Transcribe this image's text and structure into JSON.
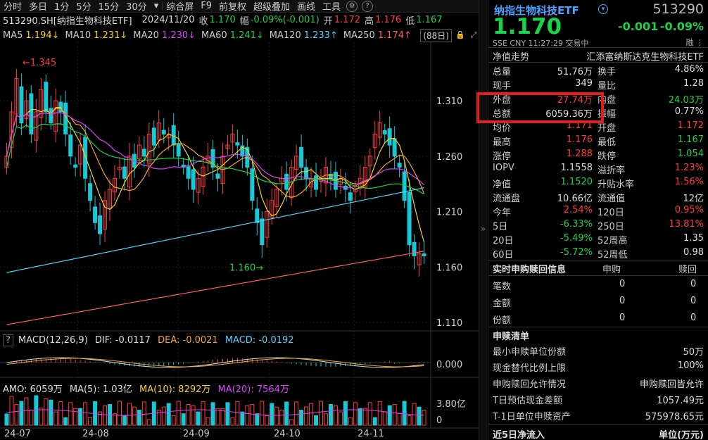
{
  "toolbar": {
    "periods": [
      "分时",
      "多日",
      "1分",
      "5分",
      "15分",
      "30分"
    ],
    "tools": [
      "综合屏",
      "F9",
      "前复权",
      "超级叠加",
      "画线",
      "工具"
    ]
  },
  "info": {
    "code_name": "513290.SH[纳指生物科技ETF]",
    "date": "2024/11/20",
    "close_label": "收",
    "close": "1.170",
    "change_label": "幅",
    "change": "-0.09%(-0.001)",
    "open_label": "开",
    "open": "1.172",
    "high_label": "高",
    "high": "1.176",
    "low_label": "低",
    "low": "1.167"
  },
  "ma_row": [
    {
      "label": "MA5",
      "value": "1.194↓",
      "color": "#ffffff"
    },
    {
      "label": "MA10",
      "value": "1.231↓",
      "color": "#f5d21b"
    },
    {
      "label": "MA20",
      "value": "1.230↓",
      "color": "#e040fb"
    },
    {
      "label": "MA60",
      "value": "1.241↓",
      "color": "#19d34a"
    },
    {
      "label": "MA120",
      "value": "1.233↑",
      "color": "#4ad3ff"
    },
    {
      "label": "MA250",
      "value": "1.174↑",
      "color": "#ff5c5c"
    }
  ],
  "ma_count": "(88日)",
  "price_axis": [
    "1.310",
    "1.260",
    "1.210",
    "1.160",
    "1.110"
  ],
  "annotations": {
    "high": "←1.345",
    "low": "1.160→"
  },
  "macd": {
    "title": "MACD(12,26,9)",
    "dif_label": "DIF:",
    "dif": "-0.0117",
    "dea_label": "DEA:",
    "dea": "-0.0021",
    "macd_label": "MACD:",
    "macd": "-0.0192",
    "axis_zero": "0.000"
  },
  "amo": {
    "title": "AMO: 6059万",
    "ma5": "MA(5): 1.03亿",
    "ma10": "MA(10): 8292万",
    "ma20": "MA(20): 7564万",
    "axis_top": "3.80亿",
    "axis_zero": "0"
  },
  "dates": [
    "24-07",
    "24-08",
    "24-09",
    "24-10",
    "24-11"
  ],
  "quote": {
    "name": "纳指生物科技ETF",
    "code": "513290",
    "price": "1.170",
    "change": "-0.001",
    "pct": "-0.09%",
    "sub": "SSE  CNY  11:27:29  交易中",
    "sub_right": "融 ⋮",
    "nav_trend_label": "净值走势",
    "fund_company": "汇添富纳斯达克生物科技ETF"
  },
  "stats": [
    {
      "l1": "总量",
      "v1": "51.76万",
      "c1": "white",
      "l2": "换手",
      "v2": "4.86%",
      "c2": "white"
    },
    {
      "l1": "现手",
      "v1": "349",
      "c1": "white",
      "l2": "量比",
      "v2": "1.28",
      "c2": "white"
    },
    {
      "l1": "外盘",
      "v1": "27.74万",
      "c1": "red",
      "l2": "内盘",
      "v2": "24.03万",
      "c2": "green"
    },
    {
      "l1": "总额",
      "v1": "6059.36万",
      "c1": "white",
      "l2": "振幅",
      "v2": "0.77%",
      "c2": "white"
    },
    {
      "l1": "均价",
      "v1": "1.171",
      "c1": "red",
      "l2": "开盘",
      "v2": "1.172",
      "c2": "red"
    },
    {
      "l1": "最高",
      "v1": "1.176",
      "c1": "red",
      "l2": "最低",
      "v2": "1.167",
      "c2": "green"
    },
    {
      "l1": "涨停",
      "v1": "1.288",
      "c1": "red",
      "l2": "跌停",
      "v2": "1.054",
      "c2": "green"
    },
    {
      "l1": "IOPV",
      "v1": "1.1558",
      "c1": "white",
      "l2": "溢折率",
      "v2": "1.23%",
      "c2": "red"
    },
    {
      "l1": "净值",
      "v1": "1.1520",
      "c1": "green",
      "l2": "升贴水率",
      "v2": "1.56%",
      "c2": "red"
    },
    {
      "l1": "流通盘",
      "v1": "10.66亿",
      "c1": "white",
      "l2": "流通值",
      "v2": "12亿",
      "c2": "white"
    },
    {
      "l1": "今年",
      "v1": "2.54%",
      "c1": "red",
      "l2": "120日",
      "v2": "0.95%",
      "c2": "red"
    },
    {
      "l1": "5日",
      "v1": "-6.33%",
      "c1": "green",
      "l2": "250日",
      "v2": "13.81%",
      "c2": "red"
    },
    {
      "l1": "20日",
      "v1": "-5.49%",
      "c1": "green",
      "l2": "52周高",
      "v2": "1.35",
      "c2": "white"
    },
    {
      "l1": "60日",
      "v1": "-5.72%",
      "c1": "green",
      "l2": "52周低",
      "v2": "0.98",
      "c2": "white"
    }
  ],
  "redeem": {
    "title": "实时申购赎回信息",
    "col1": "申购",
    "col2": "赎回",
    "rows": [
      {
        "label": "笔数",
        "a": "0",
        "b": "0"
      },
      {
        "label": "金额",
        "a": "0",
        "b": "0"
      },
      {
        "label": "份额",
        "a": "0",
        "b": "0"
      }
    ]
  },
  "subscription": {
    "title": "申赎清单",
    "rows": [
      {
        "label": "最小申赎单位份额",
        "value": "50万"
      },
      {
        "label": "现金替代比例上限",
        "value": "100%"
      },
      {
        "label": "申购赎回允许情况",
        "value": "申购赎回皆允许"
      },
      {
        "label": "T日预估现金差额",
        "value": "1057.49元"
      },
      {
        "label": "T-1日单位申赎资产",
        "value": "575978.65元"
      }
    ]
  },
  "inflow": {
    "title": "近5日净流入",
    "unit": "单位(万元)"
  },
  "colors": {
    "up": "#ff3b3b",
    "down": "#19d34a",
    "accent": "#4aa3ff"
  }
}
